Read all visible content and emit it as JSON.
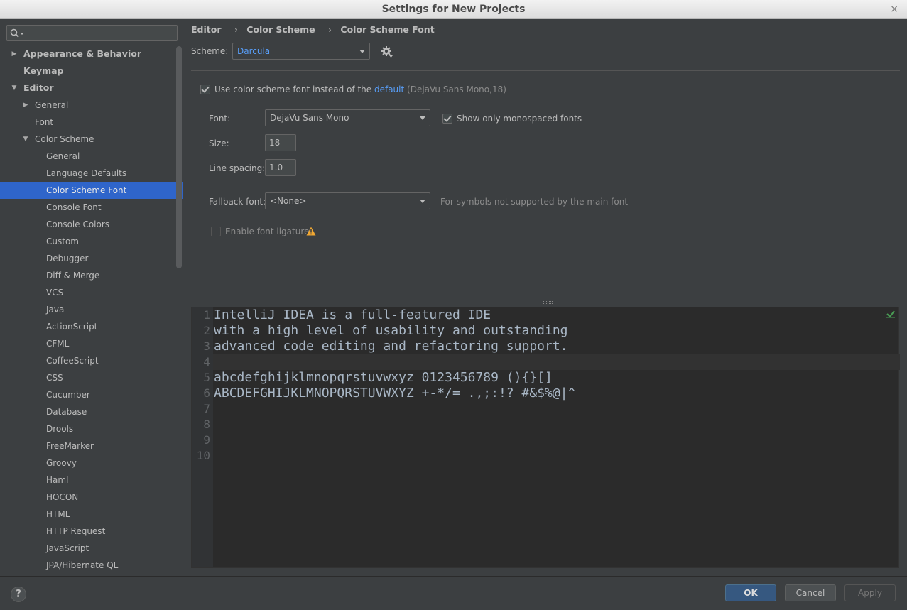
{
  "window": {
    "title": "Settings for New Projects",
    "close_glyph": "×"
  },
  "search": {
    "placeholder": ""
  },
  "sidebar": {
    "items": [
      {
        "label": "Appearance & Behavior",
        "level": 0,
        "bold": true,
        "arrow": "▶"
      },
      {
        "label": "Keymap",
        "level": 0,
        "bold": true,
        "arrow": ""
      },
      {
        "label": "Editor",
        "level": 0,
        "bold": true,
        "arrow": "▼"
      },
      {
        "label": "General",
        "level": 1,
        "arrow": "▶"
      },
      {
        "label": "Font",
        "level": 1,
        "arrow": ""
      },
      {
        "label": "Color Scheme",
        "level": 1,
        "arrow": "▼"
      },
      {
        "label": "General",
        "level": 2,
        "arrow": ""
      },
      {
        "label": "Language Defaults",
        "level": 2,
        "arrow": ""
      },
      {
        "label": "Color Scheme Font",
        "level": 2,
        "arrow": "",
        "selected": true
      },
      {
        "label": "Console Font",
        "level": 2,
        "arrow": ""
      },
      {
        "label": "Console Colors",
        "level": 2,
        "arrow": ""
      },
      {
        "label": "Custom",
        "level": 2,
        "arrow": ""
      },
      {
        "label": "Debugger",
        "level": 2,
        "arrow": ""
      },
      {
        "label": "Diff & Merge",
        "level": 2,
        "arrow": ""
      },
      {
        "label": "VCS",
        "level": 2,
        "arrow": ""
      },
      {
        "label": "Java",
        "level": 2,
        "arrow": ""
      },
      {
        "label": "ActionScript",
        "level": 2,
        "arrow": ""
      },
      {
        "label": "CFML",
        "level": 2,
        "arrow": ""
      },
      {
        "label": "CoffeeScript",
        "level": 2,
        "arrow": ""
      },
      {
        "label": "CSS",
        "level": 2,
        "arrow": ""
      },
      {
        "label": "Cucumber",
        "level": 2,
        "arrow": ""
      },
      {
        "label": "Database",
        "level": 2,
        "arrow": ""
      },
      {
        "label": "Drools",
        "level": 2,
        "arrow": ""
      },
      {
        "label": "FreeMarker",
        "level": 2,
        "arrow": ""
      },
      {
        "label": "Groovy",
        "level": 2,
        "arrow": ""
      },
      {
        "label": "Haml",
        "level": 2,
        "arrow": ""
      },
      {
        "label": "HOCON",
        "level": 2,
        "arrow": ""
      },
      {
        "label": "HTML",
        "level": 2,
        "arrow": ""
      },
      {
        "label": "HTTP Request",
        "level": 2,
        "arrow": ""
      },
      {
        "label": "JavaScript",
        "level": 2,
        "arrow": ""
      },
      {
        "label": "JPA/Hibernate QL",
        "level": 2,
        "arrow": ""
      }
    ]
  },
  "breadcrumb": {
    "items": [
      "Editor",
      "Color Scheme",
      "Color Scheme Font"
    ],
    "separator": "›"
  },
  "scheme": {
    "label": "Scheme:",
    "value": "Darcula"
  },
  "settings": {
    "use_scheme_font": {
      "checked": true,
      "label_prefix": "Use color scheme font instead of the ",
      "link": "default",
      "suffix": "(DejaVu Sans Mono,18)"
    },
    "font": {
      "label": "Font:",
      "value": "DejaVu Sans Mono"
    },
    "mono_only": {
      "checked": true,
      "label": "Show only monospaced fonts"
    },
    "size": {
      "label": "Size:",
      "value": "18"
    },
    "line_spacing": {
      "label": "Line spacing:",
      "value": "1.0"
    },
    "fallback": {
      "label": "Fallback font:",
      "value": "<None>",
      "hint": "For symbols not supported by the main font"
    },
    "ligatures": {
      "checked": false,
      "label": "Enable font ligatures"
    }
  },
  "preview": {
    "line_numbers": [
      "1",
      "2",
      "3",
      "4",
      "5",
      "6",
      "7",
      "8",
      "9",
      "10"
    ],
    "lines": [
      "IntelliJ IDEA is a full-featured IDE",
      "with a high level of usability and outstanding",
      "advanced code editing and refactoring support.",
      "",
      "abcdefghijklmnopqrstuvwxyz 0123456789 (){}[]",
      "ABCDEFGHIJKLMNOPQRSTUVWXYZ +-*/= .,;:!? #&$%@|^",
      "",
      "",
      "",
      ""
    ]
  },
  "buttons": {
    "help": "?",
    "ok": "OK",
    "cancel": "Cancel",
    "apply": "Apply"
  },
  "colors": {
    "accent": "#2f65ca",
    "link": "#589df6",
    "ok_button": "#365880"
  }
}
